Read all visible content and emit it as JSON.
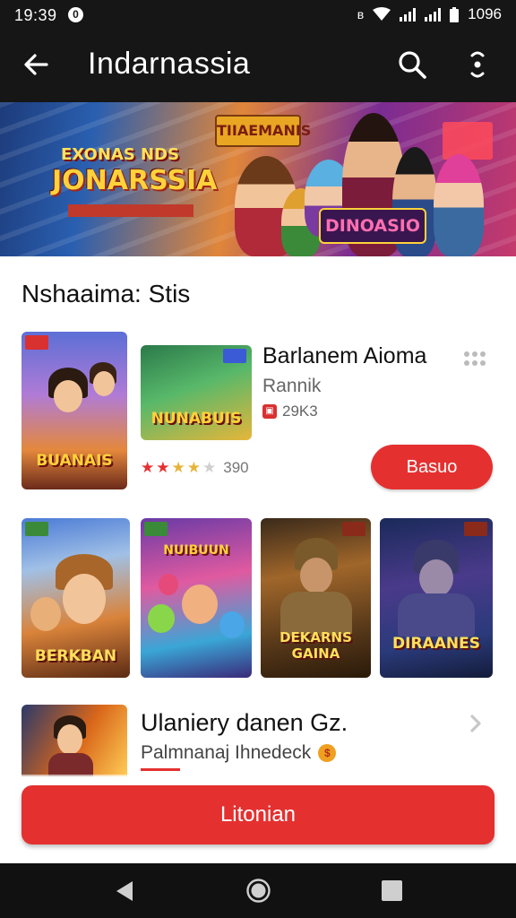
{
  "status_bar": {
    "time": "19:39",
    "notification_badge": "0",
    "bluetooth_glyph": "ʙ",
    "battery_text": "1096"
  },
  "app_bar": {
    "title": "Indarnassia"
  },
  "hero": {
    "logo_small": "EXONAS NDS",
    "logo_big": "JONARSSIA",
    "top_banner": "TIIAEMANIS",
    "badge_title": "DINOASIO"
  },
  "section": {
    "title": "Nshaaima: Stis"
  },
  "featured": {
    "tall_art_label": "BUANAIS",
    "square_art_label": "NUNABUIS",
    "title": "Barlanem Aioma",
    "subtitle": "Rannik",
    "size": "29K3",
    "rating_text": "390",
    "stars": 3.5,
    "action_label": "Basuo"
  },
  "grid": [
    {
      "label": "BERKBAN",
      "accent": "#3a8a3a"
    },
    {
      "label": "NUIBUUN",
      "accent": "#3a8a3a"
    },
    {
      "label": "DEKARNS GAINA",
      "accent": "#8a2a1a"
    },
    {
      "label": "DIRAANES",
      "accent": "#8a2a1a"
    }
  ],
  "list_item": {
    "title": "Ulaniery danen Gz.",
    "subtitle": "Palmnanaj Ihnedeck"
  },
  "bottom_button": {
    "label": "Litonian"
  },
  "colors": {
    "accent_red": "#e53030",
    "bar_dark": "#161616",
    "star_active": "#e53030",
    "star_gold": "#e6b43a"
  },
  "icons": {
    "back": "arrow-left-icon",
    "search": "search-icon",
    "more": "more-vert-icon",
    "chevron": "chevron-right-icon"
  }
}
